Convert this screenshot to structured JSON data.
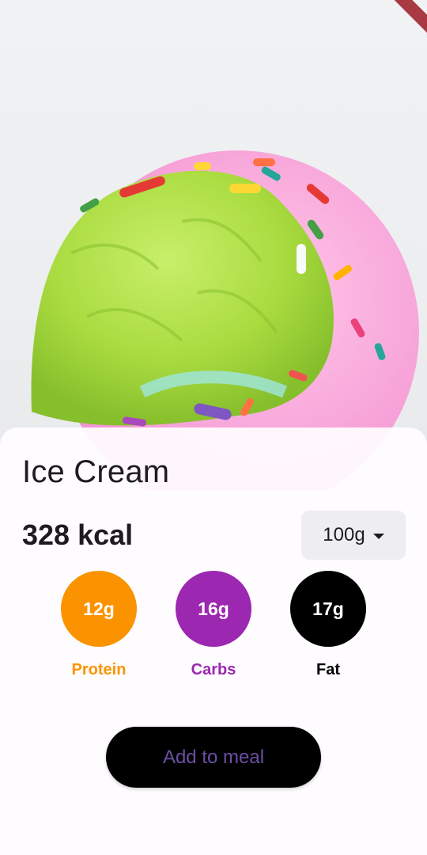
{
  "food": {
    "name": "Ice Cream",
    "calories": "328 kcal",
    "image_icon": "ice-cream-photo"
  },
  "portion": {
    "selected": "100g"
  },
  "macros": {
    "protein": {
      "value": "12g",
      "label": "Protein",
      "color": "#FB9300"
    },
    "carbs": {
      "value": "16g",
      "label": "Carbs",
      "color": "#9C27B0"
    },
    "fat": {
      "value": "17g",
      "label": "Fat",
      "color": "#000000"
    }
  },
  "actions": {
    "add_label": "Add to meal"
  },
  "colors": {
    "accent": "#6A4FA3",
    "sheet": "#FFFDFF",
    "text": "#1E1B20"
  }
}
